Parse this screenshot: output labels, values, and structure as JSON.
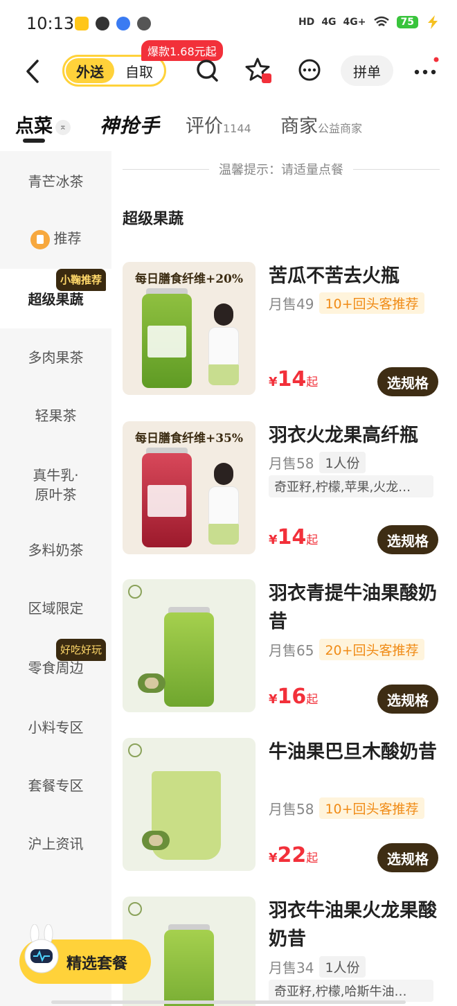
{
  "status_bar": {
    "time": "10:13",
    "network": "4G",
    "network2": "4G+",
    "battery": "75",
    "hd_label": "HD"
  },
  "nav": {
    "mode_delivery": "外送",
    "mode_pickup": "自取",
    "hot_badge": "爆款1.68元起",
    "group_order": "拼单",
    "icons": [
      "back-icon",
      "search-icon",
      "star-icon",
      "message-icon",
      "more-icon"
    ],
    "accent": "#ffd23a",
    "badge_color": "#f2303a"
  },
  "tabs": {
    "order": "点菜",
    "brand": "神抢手",
    "reviews": "评价",
    "reviews_count": "1144",
    "merchant": "商家",
    "merchant_sub": "公益商家"
  },
  "sidebar": {
    "items": [
      {
        "label": "青芒冰茶"
      },
      {
        "label": "推荐"
      },
      {
        "label": "超级果蔬",
        "tag": "小鞠推荐"
      },
      {
        "label": "多肉果茶"
      },
      {
        "label": "轻果茶"
      },
      {
        "label": "真牛乳·",
        "label2": "原叶茶"
      },
      {
        "label": "多料奶茶"
      },
      {
        "label": "区域限定"
      },
      {
        "label": "零食周边",
        "tag": "好吃好玩"
      },
      {
        "label": "小料专区"
      },
      {
        "label": "套餐专区"
      },
      {
        "label": "沪上资讯"
      }
    ]
  },
  "main": {
    "tip": "温馨提示：请适量点餐",
    "section": "超级果蔬",
    "items": [
      {
        "banner": "每日膳食纤维+20%",
        "name": "苦瓜不苦去火瓶",
        "sales": "月售49",
        "badge": "10+回头客推荐",
        "currency": "¥",
        "price": "14",
        "price_suffix": "起",
        "button": "选规格"
      },
      {
        "banner": "每日膳食纤维+35%",
        "name": "羽衣火龙果高纤瓶",
        "sales": "月售58",
        "badge": "1人份",
        "ingredients": "奇亚籽,柠檬,苹果,火龙…",
        "currency": "¥",
        "price": "14",
        "price_suffix": "起",
        "button": "选规格"
      },
      {
        "name": "羽衣青提牛油果酸奶昔",
        "sales": "月售65",
        "badge": "20+回头客推荐",
        "currency": "¥",
        "price": "16",
        "price_suffix": "起",
        "button": "选规格"
      },
      {
        "name": "牛油果巴旦木酸奶昔",
        "sales": "月售58",
        "badge": "10+回头客推荐",
        "currency": "¥",
        "price": "22",
        "price_suffix": "起",
        "button": "选规格"
      },
      {
        "name": "羽衣牛油果火龙果酸奶昔",
        "sales": "月售34",
        "badge": "1人份",
        "ingredients": "奇亚籽,柠檬,哈斯牛油…"
      }
    ]
  },
  "combo": {
    "label": "精选套餐"
  }
}
